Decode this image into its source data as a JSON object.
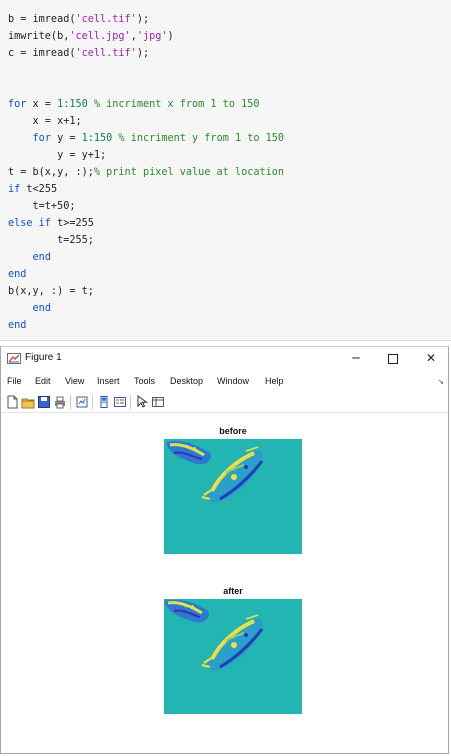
{
  "editor": {
    "lines": [
      [
        {
          "t": "b = imread(",
          "c": ""
        },
        {
          "t": "'cell.tif'",
          "c": "str"
        },
        {
          "t": ");",
          "c": ""
        }
      ],
      [
        {
          "t": "imwrite(b,",
          "c": ""
        },
        {
          "t": "'cell.jpg'",
          "c": "str"
        },
        {
          "t": ",",
          "c": ""
        },
        {
          "t": "'jpg'",
          "c": "str"
        },
        {
          "t": ")",
          "c": ""
        }
      ],
      [
        {
          "t": "c = imread(",
          "c": ""
        },
        {
          "t": "'cell.tif'",
          "c": "str"
        },
        {
          "t": ");",
          "c": ""
        }
      ],
      [],
      [],
      [
        {
          "t": "for",
          "c": "kw"
        },
        {
          "t": " x = ",
          "c": ""
        },
        {
          "t": "1:150",
          "c": "num"
        },
        {
          "t": " % incriment x from 1 to 150",
          "c": "cmt"
        }
      ],
      [
        {
          "t": "    x = x+1;",
          "c": ""
        }
      ],
      [
        {
          "t": "    ",
          "c": ""
        },
        {
          "t": "for",
          "c": "kw"
        },
        {
          "t": " y = ",
          "c": ""
        },
        {
          "t": "1:150",
          "c": "num"
        },
        {
          "t": " % incriment y from 1 to 150",
          "c": "cmt"
        }
      ],
      [
        {
          "t": "        y = y+1;",
          "c": ""
        }
      ],
      [
        {
          "t": "t = b(x,y, :);",
          "c": ""
        },
        {
          "t": "% print pixel value at location",
          "c": "cmt"
        }
      ],
      [
        {
          "t": "if",
          "c": "kw"
        },
        {
          "t": " t<255",
          "c": ""
        }
      ],
      [
        {
          "t": "    t=t+50;",
          "c": ""
        }
      ],
      [
        {
          "t": "else if",
          "c": "kw"
        },
        {
          "t": " t>=255",
          "c": ""
        }
      ],
      [
        {
          "t": "        t=255;",
          "c": ""
        }
      ],
      [
        {
          "t": "    ",
          "c": ""
        },
        {
          "t": "end",
          "c": "kw"
        }
      ],
      [
        {
          "t": "end",
          "c": "kw"
        }
      ],
      [
        {
          "t": "b(x,y, :) = t;",
          "c": ""
        }
      ],
      [
        {
          "t": "    ",
          "c": ""
        },
        {
          "t": "end",
          "c": "kw"
        }
      ],
      [
        {
          "t": "end",
          "c": "kw"
        }
      ]
    ]
  },
  "figure_window": {
    "title": "Figure 1",
    "minimize_glyph": "─",
    "close_glyph": "✕",
    "menu": [
      "File",
      "Edit",
      "View",
      "Insert",
      "Tools",
      "Desktop",
      "Window",
      "Help"
    ],
    "menu_overflow_glyph": "➘",
    "toolbar": [
      {
        "icon": "new-figure-icon"
      },
      {
        "icon": "open-file-icon"
      },
      {
        "icon": "save-icon"
      },
      {
        "icon": "print-icon"
      },
      {
        "sep": true
      },
      {
        "icon": "link-plot-icon"
      },
      {
        "sep": true
      },
      {
        "icon": "insert-colorbar-icon"
      },
      {
        "icon": "insert-legend-icon"
      },
      {
        "sep": true
      },
      {
        "icon": "edit-plot-pointer-icon"
      },
      {
        "icon": "property-inspector-icon"
      }
    ],
    "axes": [
      {
        "title": "before"
      },
      {
        "title": "after"
      }
    ]
  },
  "colors": {
    "colormap_background": "#22b5b2",
    "code_background": "#f6f6f6",
    "keyword": "#0a4fd6",
    "string": "#a11fb6",
    "comment": "#2a8a2a"
  }
}
